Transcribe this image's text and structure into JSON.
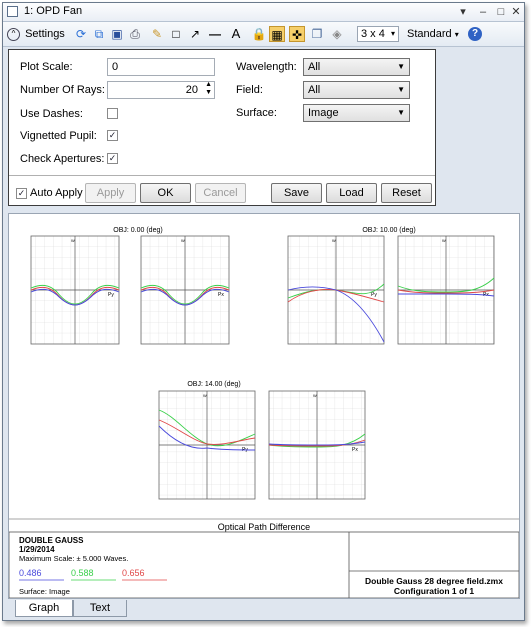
{
  "window": {
    "title": "1: OPD Fan"
  },
  "toolbar": {
    "settings_label": "Settings",
    "layout_label": "3 x 4",
    "standard_label": "Standard"
  },
  "settings": {
    "plot_scale_label": "Plot Scale:",
    "plot_scale_value": "0",
    "num_rays_label": "Number Of Rays:",
    "num_rays_value": "20",
    "use_dashes_label": "Use Dashes:",
    "use_dashes_checked": false,
    "vignetted_label": "Vignetted Pupil:",
    "vignetted_checked": true,
    "check_apertures_label": "Check Apertures:",
    "check_apertures_checked": true,
    "wavelength_label": "Wavelength:",
    "wavelength_value": "All",
    "field_label": "Field:",
    "field_value": "All",
    "surface_label": "Surface:",
    "surface_value": "Image",
    "auto_apply_label": "Auto Apply",
    "auto_apply_checked": true,
    "apply_label": "Apply",
    "ok_label": "OK",
    "cancel_label": "Cancel",
    "save_label": "Save",
    "load_label": "Load",
    "reset_label": "Reset"
  },
  "plots": {
    "field1": "OBJ: 0.00 (deg)",
    "field2": "OBJ: 10.00 (deg)",
    "field3": "OBJ: 14.00 (deg)",
    "py_label": "Py",
    "px_label": "Px",
    "w_label": "W"
  },
  "footer": {
    "title": "Optical Path Difference",
    "lens_name": "DOUBLE GAUSS",
    "date": "1/29/2014",
    "max_scale": "Maximum Scale: ± 5.000 Waves.",
    "wavelengths": [
      {
        "value": "0.486",
        "color": "#4a4adc"
      },
      {
        "value": "0.588",
        "color": "#3ad04a"
      },
      {
        "value": "0.656",
        "color": "#e04848"
      }
    ],
    "surface": "Surface: Image",
    "file": "Double Gauss 28 degree field.zmx",
    "config": "Configuration 1 of 1"
  },
  "tabs": {
    "graph": "Graph",
    "text": "Text"
  }
}
